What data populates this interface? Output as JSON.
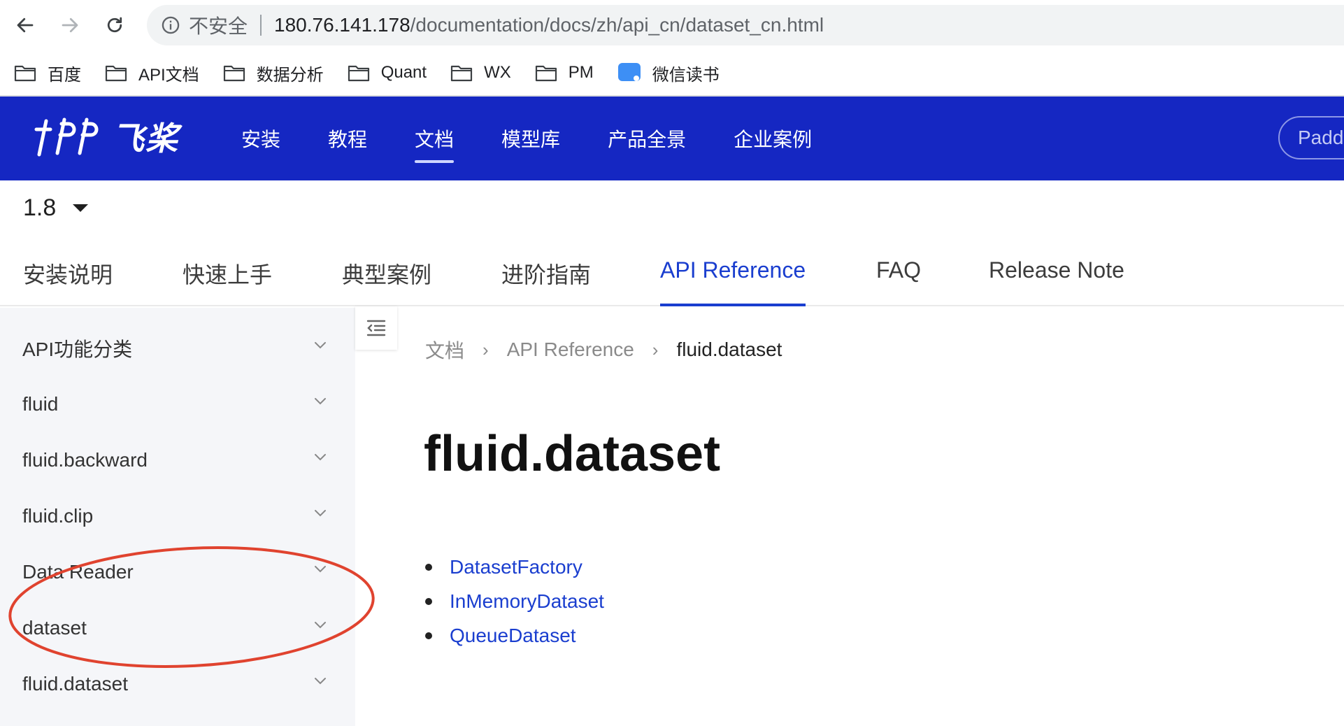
{
  "browser": {
    "security_label": "不安全",
    "url_host": "180.76.141.178",
    "url_path": "/documentation/docs/zh/api_cn/dataset_cn.html",
    "icons": [
      "back-arrow-icon",
      "forward-arrow-icon",
      "reload-icon",
      "info-icon"
    ]
  },
  "bookmarks": [
    {
      "label": "百度",
      "icon": "folder-icon"
    },
    {
      "label": "API文档",
      "icon": "folder-icon"
    },
    {
      "label": "数据分析",
      "icon": "folder-icon"
    },
    {
      "label": "Quant",
      "icon": "folder-icon"
    },
    {
      "label": "WX",
      "icon": "folder-icon"
    },
    {
      "label": "PM",
      "icon": "folder-icon"
    },
    {
      "label": "微信读书",
      "icon": "weread-icon"
    }
  ],
  "header": {
    "logo_text": "飞桨",
    "nav": [
      "安装",
      "教程",
      "文档",
      "模型库",
      "产品全景",
      "企业案例"
    ],
    "active_nav": "文档",
    "button_label": "Padd",
    "background": "#1527c2"
  },
  "version": {
    "value": "1.8"
  },
  "doc_tabs": [
    "安装说明",
    "快速上手",
    "典型案例",
    "进阶指南",
    "API Reference",
    "FAQ",
    "Release Note"
  ],
  "active_tab": "API Reference",
  "sidebar": {
    "items": [
      "API功能分类",
      "fluid",
      "fluid.backward",
      "fluid.clip",
      "Data Reader",
      "dataset",
      "fluid.dataset"
    ]
  },
  "breadcrumb": [
    "文档",
    "API Reference",
    "fluid.dataset"
  ],
  "page": {
    "title": "fluid.dataset",
    "links": [
      "DatasetFactory",
      "InMemoryDataset",
      "QueueDataset"
    ],
    "link_color": "#1a3ecf"
  },
  "annotation": {
    "color": "#e0432f"
  }
}
